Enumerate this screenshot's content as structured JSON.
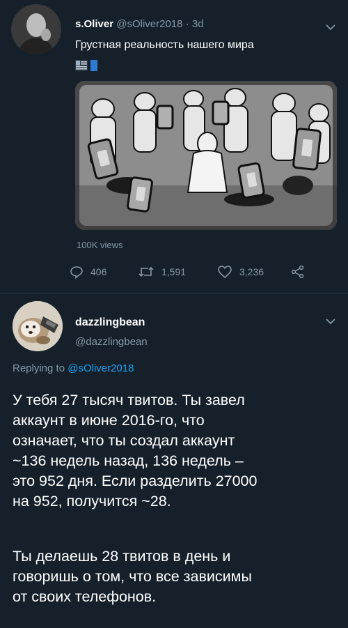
{
  "tweet1": {
    "display_name": "s.Oliver",
    "handle": "@sOliver2018",
    "separator": "·",
    "age": "3d",
    "text": "Грустная реальность нашего мира",
    "views": "100K views",
    "actions": {
      "reply_count": "406",
      "retweet_count": "1,591",
      "like_count": "3,236"
    },
    "icons": [
      "chevron-down-icon",
      "reply-icon",
      "retweet-icon",
      "like-icon",
      "share-icon"
    ]
  },
  "tweet2": {
    "display_name": "dazzlingbean",
    "handle": "@dazzlingbean",
    "replying_prefix": "Replying to ",
    "replying_mention": "@sOliver2018",
    "paragraph1": "У тебя 27 тысяч твитов. Ты завел\nаккаунт в июне 2016-го, что\nозначает, что ты создал аккаунт\n~136 недель назад, 136 недель –\nэто 952 дня. Если разделить 27000\nна 952, получится ~28.",
    "paragraph2": "Ты делаешь 28 твитов в день и\nговоришь о том, что все зависимы\nот своих телефонов."
  },
  "colors": {
    "background": "#15202b",
    "secondary_text": "#8899a6",
    "link": "#1da1f2",
    "separator": "#2a3a4a"
  }
}
